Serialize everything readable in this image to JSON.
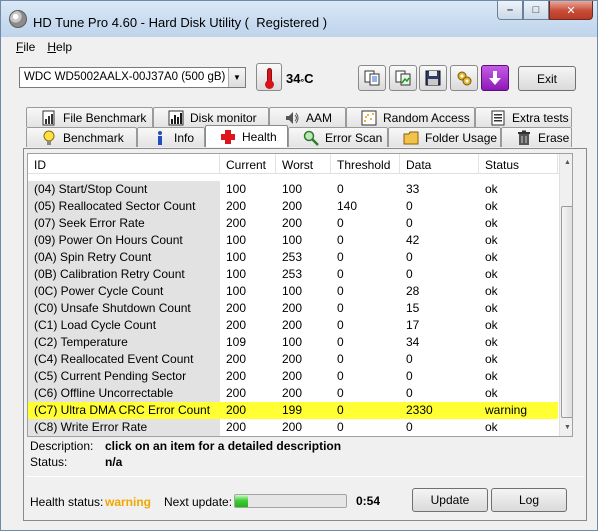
{
  "window": {
    "title": "HD Tune Pro 4.60 - Hard Disk Utility (  Registered )",
    "caption_minimize": "–",
    "caption_maximize": "□",
    "caption_close": "✕"
  },
  "menu": {
    "items": [
      {
        "label": "File",
        "accel": "F",
        "rest": "ile"
      },
      {
        "label": "Help",
        "accel": "H",
        "rest": "elp"
      }
    ]
  },
  "toolbar": {
    "drive": "WDC WD5002AALX-00J37A0 (500 gB)",
    "temperature": "34",
    "temperature_unit": "C",
    "temperature_degree": "°",
    "exit_label": "Exit",
    "icons": [
      "copy-text-icon",
      "copy-screenshot-icon",
      "save-icon",
      "options-icon",
      "download-icon"
    ],
    "colors": {
      "download_button": "#a020c8"
    }
  },
  "tabs": {
    "row1": [
      {
        "label": "File Benchmark",
        "icon": "file-benchmark-icon"
      },
      {
        "label": "Disk monitor",
        "icon": "disk-monitor-icon"
      },
      {
        "label": "AAM",
        "icon": "speaker-icon"
      },
      {
        "label": "Random Access",
        "icon": "random-access-icon"
      },
      {
        "label": "Extra tests",
        "icon": "extra-tests-icon"
      }
    ],
    "row2": [
      {
        "label": "Benchmark",
        "icon": "lightbulb-icon"
      },
      {
        "label": "Info",
        "icon": "info-icon"
      },
      {
        "label": "Health",
        "icon": "health-cross-icon",
        "active": true
      },
      {
        "label": "Error Scan",
        "icon": "magnifier-icon"
      },
      {
        "label": "Folder Usage",
        "icon": "folder-icon"
      },
      {
        "label": "Erase",
        "icon": "trash-icon"
      }
    ]
  },
  "smart": {
    "columns": [
      "ID",
      "Current",
      "Worst",
      "Threshold",
      "Data",
      "Status"
    ],
    "rows": [
      {
        "id": "(04) Start/Stop Count",
        "current": "100",
        "worst": "100",
        "threshold": "0",
        "data": "33",
        "status": "ok"
      },
      {
        "id": "(05) Reallocated Sector Count",
        "current": "200",
        "worst": "200",
        "threshold": "140",
        "data": "0",
        "status": "ok"
      },
      {
        "id": "(07) Seek Error Rate",
        "current": "200",
        "worst": "200",
        "threshold": "0",
        "data": "0",
        "status": "ok"
      },
      {
        "id": "(09) Power On Hours Count",
        "current": "100",
        "worst": "100",
        "threshold": "0",
        "data": "42",
        "status": "ok"
      },
      {
        "id": "(0A) Spin Retry Count",
        "current": "100",
        "worst": "253",
        "threshold": "0",
        "data": "0",
        "status": "ok"
      },
      {
        "id": "(0B) Calibration Retry Count",
        "current": "100",
        "worst": "253",
        "threshold": "0",
        "data": "0",
        "status": "ok"
      },
      {
        "id": "(0C) Power Cycle Count",
        "current": "100",
        "worst": "100",
        "threshold": "0",
        "data": "28",
        "status": "ok"
      },
      {
        "id": "(C0) Unsafe Shutdown Count",
        "current": "200",
        "worst": "200",
        "threshold": "0",
        "data": "15",
        "status": "ok"
      },
      {
        "id": "(C1) Load Cycle Count",
        "current": "200",
        "worst": "200",
        "threshold": "0",
        "data": "17",
        "status": "ok"
      },
      {
        "id": "(C2) Temperature",
        "current": "109",
        "worst": "100",
        "threshold": "0",
        "data": "34",
        "status": "ok"
      },
      {
        "id": "(C4) Reallocated Event Count",
        "current": "200",
        "worst": "200",
        "threshold": "0",
        "data": "0",
        "status": "ok"
      },
      {
        "id": "(C5) Current Pending Sector",
        "current": "200",
        "worst": "200",
        "threshold": "0",
        "data": "0",
        "status": "ok"
      },
      {
        "id": "(C6) Offline Uncorrectable",
        "current": "200",
        "worst": "200",
        "threshold": "0",
        "data": "0",
        "status": "ok"
      },
      {
        "id": "(C7) Ultra DMA CRC Error Count",
        "current": "200",
        "worst": "199",
        "threshold": "0",
        "data": "2330",
        "status": "warning",
        "highlight": true
      },
      {
        "id": "(C8) Write Error Rate",
        "current": "200",
        "worst": "200",
        "threshold": "0",
        "data": "0",
        "status": "ok"
      }
    ],
    "colors": {
      "warning_row": "#ffff33",
      "id_column_bg": "#e2e2e2"
    }
  },
  "description": {
    "label": "Description:",
    "value": "click on an item for a detailed description",
    "status_label": "Status:",
    "status_value": "n/a"
  },
  "footer": {
    "health_label": "Health status:",
    "health_value": "warning",
    "next_update_label": "Next update:",
    "next_update_time": "0:54",
    "progress_fraction": 0.12,
    "update_label": "Update",
    "log_label": "Log",
    "colors": {
      "health_warning": "#f0a800",
      "progress": "#3fcf34"
    }
  }
}
